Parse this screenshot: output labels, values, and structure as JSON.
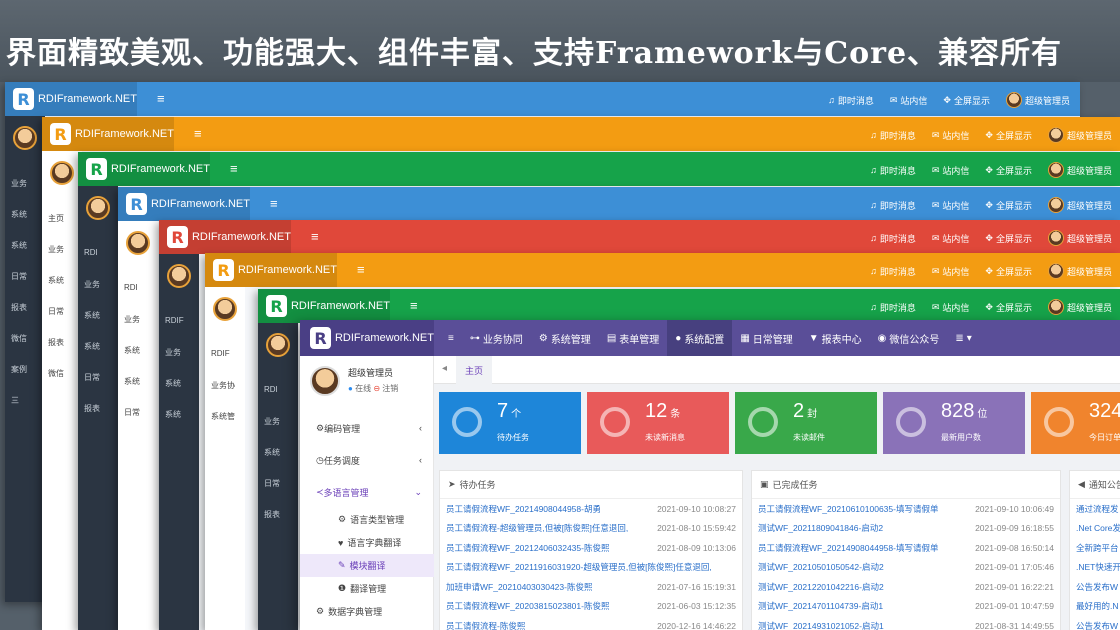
{
  "banner": {
    "title": "界面精致美观、功能强大、组件丰富、支持Framework与Core、兼容所有"
  },
  "app": {
    "logo_text": "RDIFramework.NET",
    "logo_letter": "R",
    "menu_icon": "bars-icon"
  },
  "top_actions": {
    "instant": "即时消息",
    "inbox": "站内信",
    "fullscreen": "全屏显示",
    "user": "超级管理员"
  },
  "layers": [
    {
      "color": "#3d8fd6",
      "side": [
        "业务",
        "系统",
        "系统",
        "日常",
        "报表",
        "微信",
        "案例",
        "三"
      ]
    },
    {
      "color": "#f39c12",
      "side": [
        "主页",
        "业务",
        "系统",
        "日常",
        "报表",
        "微信"
      ]
    },
    {
      "color": "#16a34a",
      "side": [
        "RDI",
        "业务",
        "系统",
        "系统",
        "日常",
        "报表"
      ]
    },
    {
      "color": "#3d8fd6",
      "side": [
        "RDI",
        "业务",
        "系统",
        "系统",
        "日常"
      ]
    },
    {
      "color": "#e0483a",
      "side": [
        "RDIF",
        "业务",
        "系统",
        "系统"
      ]
    },
    {
      "color": "#f39c12",
      "side": [
        "RDIF",
        "业务协",
        "系统管"
      ]
    },
    {
      "color": "#16a34a",
      "side": [
        "RDI",
        "业务",
        "系统",
        "日常",
        "报表"
      ]
    }
  ],
  "front": {
    "menu": [
      {
        "icon": "bars-icon",
        "label": ""
      },
      {
        "icon": "sitemap-icon",
        "label": "业务协同"
      },
      {
        "icon": "cogs-icon",
        "label": "系统管理"
      },
      {
        "icon": "table-icon",
        "label": "表单管理"
      },
      {
        "icon": "circle-icon",
        "label": "系统配置"
      },
      {
        "icon": "calendar-icon",
        "label": "日常管理"
      },
      {
        "icon": "filter-icon",
        "label": "报表中心"
      },
      {
        "icon": "wechat-icon",
        "label": "微信公众号"
      },
      {
        "icon": "list-icon",
        "label": ""
      }
    ],
    "user": {
      "name": "超级管理员",
      "online": "在线",
      "logout": "注销"
    },
    "nav": [
      {
        "label": "编码管理",
        "icon": "gear-icon"
      },
      {
        "label": "任务调度",
        "icon": "clock-icon"
      },
      {
        "label": "多语言管理",
        "icon": "share-icon",
        "open": true
      }
    ],
    "sub_nav": [
      "语言类型管理",
      "语言字典翻译",
      "模块翻译",
      "翻译管理",
      "数据字典管理"
    ],
    "tab_home": "主页",
    "stats": [
      {
        "num": "7",
        "unit": "个",
        "label": "待办任务",
        "color": "#1e86d9"
      },
      {
        "num": "12",
        "unit": "条",
        "label": "未读新消息",
        "color": "#e85a5a"
      },
      {
        "num": "2",
        "unit": "封",
        "label": "未读邮件",
        "color": "#39a84a"
      },
      {
        "num": "828",
        "unit": "位",
        "label": "最新用户数",
        "color": "#8a72b8"
      },
      {
        "num": "324",
        "unit": "",
        "label": "今日订单",
        "color": "#f0842d"
      }
    ],
    "todo": {
      "title": "待办任务",
      "rows": [
        [
          "员工请假流程WF_20214908044958-胡勇",
          "2021-09-10 10:08:27"
        ],
        [
          "员工请假流程-超级管理员,但被[陈俊熙]任意退回,",
          "2021-08-10 15:59:42"
        ],
        [
          "员工请假流程WF_20212406032435-陈俊熙",
          "2021-08-09 10:13:06"
        ],
        [
          "员工请假流程WF_20211916031920-超级管理员,但被[陈俊熙]任意退回,",
          ""
        ],
        [
          "加班申请WF_20210403030423-陈俊熙",
          "2021-07-16 15:19:31"
        ],
        [
          "员工请假流程WF_20203815023801-陈俊熙",
          "2021-06-03 15:12:35"
        ],
        [
          "员工请假流程-陈俊熙",
          "2020-12-16 14:46:22"
        ]
      ]
    },
    "done": {
      "title": "已完成任务",
      "rows": [
        [
          "员工请假流程WF_20210610100635-填写请假单",
          "2021-09-10 10:06:49"
        ],
        [
          "测试WF_20211809041846-启动2",
          "2021-09-09 16:18:55"
        ],
        [
          "员工请假流程WF_20214908044958-填写请假单",
          "2021-09-08 16:50:14"
        ],
        [
          "测试WF_20210501050542-启动2",
          "2021-09-01 17:05:46"
        ],
        [
          "测试WF_20212201042216-启动2",
          "2021-09-01 16:22:21"
        ],
        [
          "测试WF_20214701104739-启动1",
          "2021-09-01 10:47:59"
        ],
        [
          "测试WF_20214931021052-启动1",
          "2021-08-31 14:49:55"
        ]
      ]
    },
    "notice": {
      "title": "通知公告",
      "rows": [
        "通过流程发",
        ".Net Core发",
        "全新跨平台",
        ".NET快速开",
        "公告发布W",
        "最好用的.N",
        "公告发布W"
      ]
    }
  }
}
